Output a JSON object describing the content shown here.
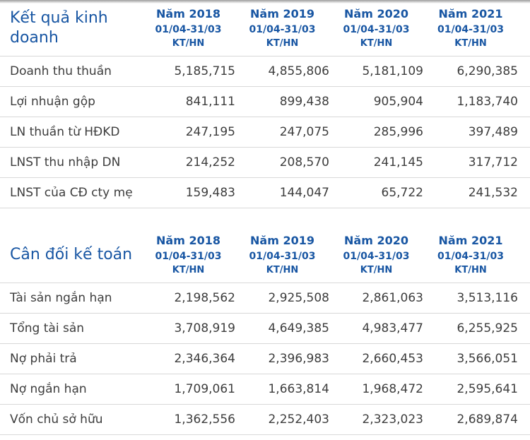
{
  "colors": {
    "accent_blue": "#1856a3",
    "text_dark": "#3d3d3d",
    "divider": "#d8d8d8"
  },
  "columns": [
    {
      "year": "Năm 2018",
      "period": "01/04-31/03",
      "basis": "KT/HN"
    },
    {
      "year": "Năm 2019",
      "period": "01/04-31/03",
      "basis": "KT/HN"
    },
    {
      "year": "Năm 2020",
      "period": "01/04-31/03",
      "basis": "KT/HN"
    },
    {
      "year": "Năm 2021",
      "period": "01/04-31/03",
      "basis": "KT/HN"
    }
  ],
  "sections": [
    {
      "title": "Kết quả kinh doanh",
      "rows": [
        {
          "label": "Doanh thu thuần",
          "values": [
            "5,185,715",
            "4,855,806",
            "5,181,109",
            "6,290,385"
          ]
        },
        {
          "label": "Lợi nhuận gộp",
          "values": [
            "841,111",
            "899,438",
            "905,904",
            "1,183,740"
          ]
        },
        {
          "label": "LN thuần từ HĐKD",
          "values": [
            "247,195",
            "247,075",
            "285,996",
            "397,489"
          ]
        },
        {
          "label": "LNST thu nhập DN",
          "values": [
            "214,252",
            "208,570",
            "241,145",
            "317,712"
          ]
        },
        {
          "label": "LNST của CĐ cty mẹ",
          "values": [
            "159,483",
            "144,047",
            "65,722",
            "241,532"
          ]
        }
      ]
    },
    {
      "title": "Cân đối kế toán",
      "rows": [
        {
          "label": "Tài sản ngắn hạn",
          "values": [
            "2,198,562",
            "2,925,508",
            "2,861,063",
            "3,513,116"
          ]
        },
        {
          "label": "Tổng tài sản",
          "values": [
            "3,708,919",
            "4,649,385",
            "4,983,477",
            "6,255,925"
          ]
        },
        {
          "label": "Nợ phải trả",
          "values": [
            "2,346,364",
            "2,396,983",
            "2,660,453",
            "3,566,051"
          ]
        },
        {
          "label": "Nợ ngắn hạn",
          "values": [
            "1,709,061",
            "1,663,814",
            "1,968,472",
            "2,595,641"
          ]
        },
        {
          "label": "Vốn chủ sở hữu",
          "values": [
            "1,362,556",
            "2,252,403",
            "2,323,023",
            "2,689,874"
          ]
        }
      ]
    }
  ]
}
